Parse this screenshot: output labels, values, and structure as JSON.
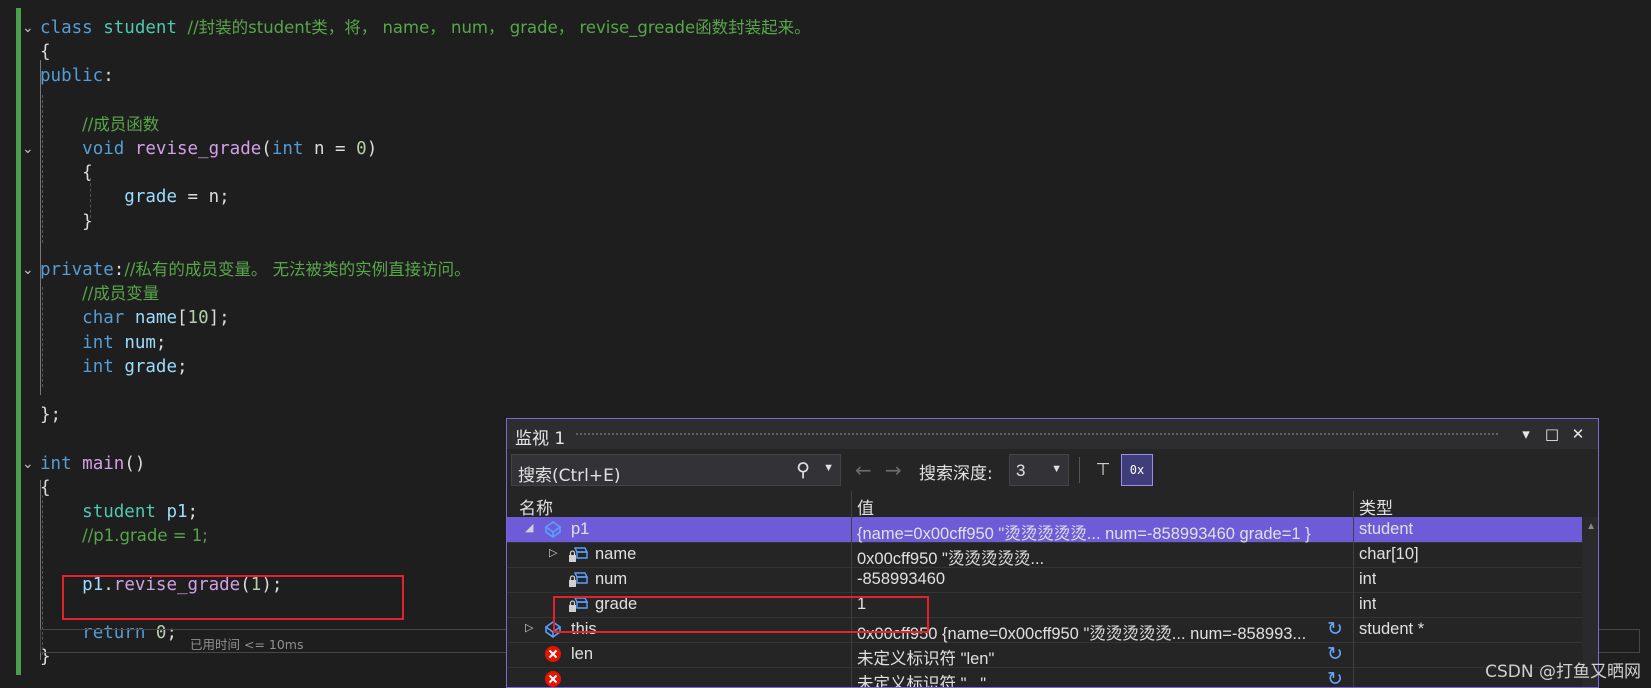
{
  "code": {
    "lines": [
      {
        "tokens": [
          {
            "c": "kw",
            "t": "class "
          },
          {
            "c": "ty",
            "t": "student "
          },
          {
            "c": "cm",
            "t": "//封装的student类，将， name， num， grade， revise_greade函数封装起来。"
          }
        ]
      },
      {
        "tokens": [
          {
            "c": "plain",
            "t": "{"
          }
        ]
      },
      {
        "tokens": [
          {
            "c": "kw",
            "t": "public"
          },
          {
            "c": "plain",
            "t": ":"
          }
        ]
      },
      {
        "tokens": []
      },
      {
        "tokens": [
          {
            "c": "plain",
            "t": "    "
          },
          {
            "c": "cm",
            "t": "//成员函数"
          }
        ]
      },
      {
        "tokens": [
          {
            "c": "plain",
            "t": "    "
          },
          {
            "c": "kw",
            "t": "void "
          },
          {
            "c": "fn",
            "t": "revise_grade"
          },
          {
            "c": "plain",
            "t": "("
          },
          {
            "c": "kw",
            "t": "int "
          },
          {
            "c": "plain",
            "t": "n = "
          },
          {
            "c": "num",
            "t": "0"
          },
          {
            "c": "plain",
            "t": ")"
          }
        ]
      },
      {
        "tokens": [
          {
            "c": "plain",
            "t": "    {"
          }
        ]
      },
      {
        "tokens": [
          {
            "c": "plain",
            "t": "        "
          },
          {
            "c": "va",
            "t": "grade"
          },
          {
            "c": "plain",
            "t": " = n;"
          }
        ]
      },
      {
        "tokens": [
          {
            "c": "plain",
            "t": "    }"
          }
        ]
      },
      {
        "tokens": []
      },
      {
        "tokens": [
          {
            "c": "kw",
            "t": "private"
          },
          {
            "c": "plain",
            "t": ":"
          },
          {
            "c": "cm",
            "t": "//私有的成员变量。 无法被类的实例直接访问。"
          }
        ]
      },
      {
        "tokens": [
          {
            "c": "plain",
            "t": "    "
          },
          {
            "c": "cm",
            "t": "//成员变量"
          }
        ]
      },
      {
        "tokens": [
          {
            "c": "plain",
            "t": "    "
          },
          {
            "c": "kw",
            "t": "char "
          },
          {
            "c": "va",
            "t": "name"
          },
          {
            "c": "plain",
            "t": "["
          },
          {
            "c": "num",
            "t": "10"
          },
          {
            "c": "plain",
            "t": "];"
          }
        ]
      },
      {
        "tokens": [
          {
            "c": "plain",
            "t": "    "
          },
          {
            "c": "kw",
            "t": "int "
          },
          {
            "c": "va",
            "t": "num"
          },
          {
            "c": "plain",
            "t": ";"
          }
        ]
      },
      {
        "tokens": [
          {
            "c": "plain",
            "t": "    "
          },
          {
            "c": "kw",
            "t": "int "
          },
          {
            "c": "va",
            "t": "grade"
          },
          {
            "c": "plain",
            "t": ";"
          }
        ]
      },
      {
        "tokens": []
      },
      {
        "tokens": [
          {
            "c": "plain",
            "t": "};"
          }
        ]
      },
      {
        "tokens": []
      },
      {
        "tokens": [
          {
            "c": "kw",
            "t": "int "
          },
          {
            "c": "fn",
            "t": "main"
          },
          {
            "c": "plain",
            "t": "()"
          }
        ]
      },
      {
        "tokens": [
          {
            "c": "plain",
            "t": "{"
          }
        ]
      },
      {
        "tokens": [
          {
            "c": "plain",
            "t": "    "
          },
          {
            "c": "ty",
            "t": "student "
          },
          {
            "c": "va",
            "t": "p1"
          },
          {
            "c": "plain",
            "t": ";"
          }
        ]
      },
      {
        "tokens": [
          {
            "c": "plain",
            "t": "    "
          },
          {
            "c": "cm",
            "t": "//p1.grade = 1;"
          }
        ]
      },
      {
        "tokens": []
      },
      {
        "tokens": [
          {
            "c": "plain",
            "t": "    "
          },
          {
            "c": "va",
            "t": "p1"
          },
          {
            "c": "plain",
            "t": "."
          },
          {
            "c": "fn",
            "t": "revise_grade"
          },
          {
            "c": "plain",
            "t": "("
          },
          {
            "c": "num",
            "t": "1"
          },
          {
            "c": "plain",
            "t": ");"
          }
        ]
      },
      {
        "tokens": []
      },
      {
        "tokens": [
          {
            "c": "plain",
            "t": "    "
          },
          {
            "c": "kw",
            "t": "return "
          },
          {
            "c": "num",
            "t": "0"
          },
          {
            "c": "plain",
            "t": ";"
          }
        ]
      },
      {
        "tokens": [
          {
            "c": "plain",
            "t": "}"
          }
        ]
      }
    ],
    "time_note": "已用时间 <= 10ms"
  },
  "watch": {
    "title": "监视 1",
    "search_placeholder": "搜索(Ctrl+E)",
    "search_depth_label": "搜索深度:",
    "search_depth_value": "3",
    "hex_label": "0x",
    "columns": {
      "name": "名称",
      "value": "值",
      "type": "类型"
    },
    "rows": [
      {
        "expander": "◢",
        "icon": "object-icon",
        "name": "p1",
        "value": "{name=0x00cff950 \"烫烫烫烫烫... num=-858993460 grade=1 }",
        "type": "student",
        "selected": true,
        "indent": 0,
        "refresh": false
      },
      {
        "expander": "▷",
        "icon": "private-field-icon",
        "name": "name",
        "value": "0x00cff950 \"烫烫烫烫烫...",
        "type": "char[10]",
        "selected": false,
        "indent": 1,
        "refresh": false
      },
      {
        "expander": "",
        "icon": "private-field-icon",
        "name": "num",
        "value": "-858993460",
        "type": "int",
        "selected": false,
        "indent": 1,
        "refresh": false
      },
      {
        "expander": "",
        "icon": "private-field-icon",
        "name": "grade",
        "value": "1",
        "type": "int",
        "selected": false,
        "indent": 1,
        "refresh": false
      },
      {
        "expander": "▷",
        "icon": "object-icon",
        "name": "this",
        "value": "0x00cff950 {name=0x00cff950 \"烫烫烫烫烫... num=-858993...",
        "type": "student *",
        "selected": false,
        "indent": 0,
        "refresh": true
      },
      {
        "expander": "",
        "icon": "error-icon",
        "name": "len",
        "value": "未定义标识符 \"len\"",
        "type": "",
        "selected": false,
        "indent": 0,
        "refresh": true
      },
      {
        "expander": "",
        "icon": "error-icon",
        "name": "",
        "value": "未定义标识符 \"...\"",
        "type": "",
        "selected": false,
        "indent": 0,
        "refresh": true
      }
    ]
  },
  "watermark": "CSDN @打鱼又晒网",
  "colors": {
    "accent": "#6e5bd8",
    "highlight_box": "#e5222b",
    "change_bar": "#4aa04a"
  }
}
